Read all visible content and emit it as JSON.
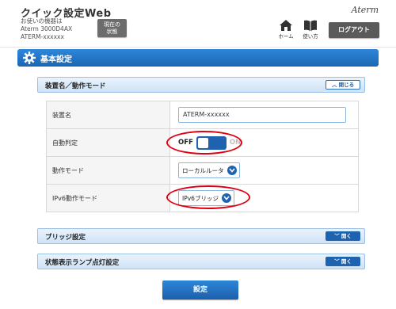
{
  "header": {
    "app_title": "クイック設定Web",
    "device_info_line1": "お使いの機器は",
    "device_info_line2": "Aterm 3000D4AX",
    "device_info_line3": "ATERM-xxxxxx",
    "status_button_line1": "現在の",
    "status_button_line2": "状態",
    "brand": "Aterm",
    "home_label": "ホーム",
    "help_label": "使い方",
    "logout_label": "ログアウト"
  },
  "page": {
    "title": "基本設定",
    "accent_color": "#1f63b0"
  },
  "sections": {
    "device": {
      "title": "装置名／動作モード",
      "collapse_label": "閉じる",
      "rows": {
        "device_name": {
          "label": "装置名",
          "value": "ATERM-xxxxxx"
        },
        "auto_detect": {
          "label": "自動判定",
          "off_label": "OFF",
          "on_label": "ON",
          "state": "OFF"
        },
        "op_mode": {
          "label": "動作モード",
          "value": "ローカルルータ"
        },
        "ipv6_mode": {
          "label": "IPv6動作モード",
          "value": "IPv6ブリッジ"
        }
      }
    },
    "bridge": {
      "title": "ブリッジ設定",
      "expand_label": "開く"
    },
    "lamp": {
      "title": "状態表示ランプ点灯設定",
      "expand_label": "開く"
    }
  },
  "submit_label": "設定"
}
